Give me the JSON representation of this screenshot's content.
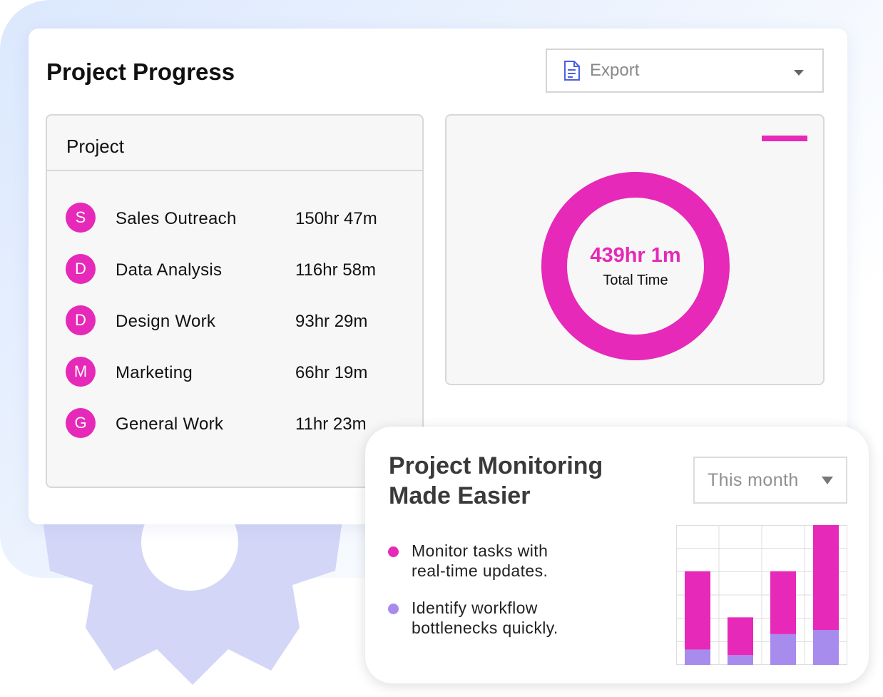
{
  "colors": {
    "accent": "#e629b8",
    "secondary": "#a78bed",
    "gear": "#d4d6f7"
  },
  "header": {
    "title": "Project Progress",
    "export_label": "Export"
  },
  "projects": {
    "header": "Project",
    "items": [
      {
        "initial": "S",
        "name": "Sales Outreach",
        "time": "150hr 47m"
      },
      {
        "initial": "D",
        "name": "Data Analysis",
        "time": "116hr 58m"
      },
      {
        "initial": "D",
        "name": "Design Work",
        "time": "93hr 29m"
      },
      {
        "initial": "M",
        "name": "Marketing",
        "time": "66hr 19m"
      },
      {
        "initial": "G",
        "name": "General Work",
        "time": "11hr 23m"
      }
    ]
  },
  "summary": {
    "total_value": "439hr 1m",
    "total_label": "Total Time"
  },
  "monitoring": {
    "title_line1": "Project Monitoring",
    "title_line2": "Made Easier",
    "period": "This month",
    "bullets": [
      {
        "line1": "Monitor tasks with",
        "line2": "real-time updates."
      },
      {
        "line1": "Identify workflow",
        "line2": "bottlenecks quickly."
      }
    ]
  },
  "chart_data": {
    "type": "bar",
    "stacked": true,
    "categories": [
      "",
      "",
      "",
      ""
    ],
    "ylim": [
      0,
      100
    ],
    "grid": true,
    "series": [
      {
        "color": "#a78bed",
        "values": [
          11,
          7,
          22,
          25
        ]
      },
      {
        "color": "#e629b8",
        "values": [
          56,
          27,
          45,
          75
        ]
      }
    ]
  }
}
